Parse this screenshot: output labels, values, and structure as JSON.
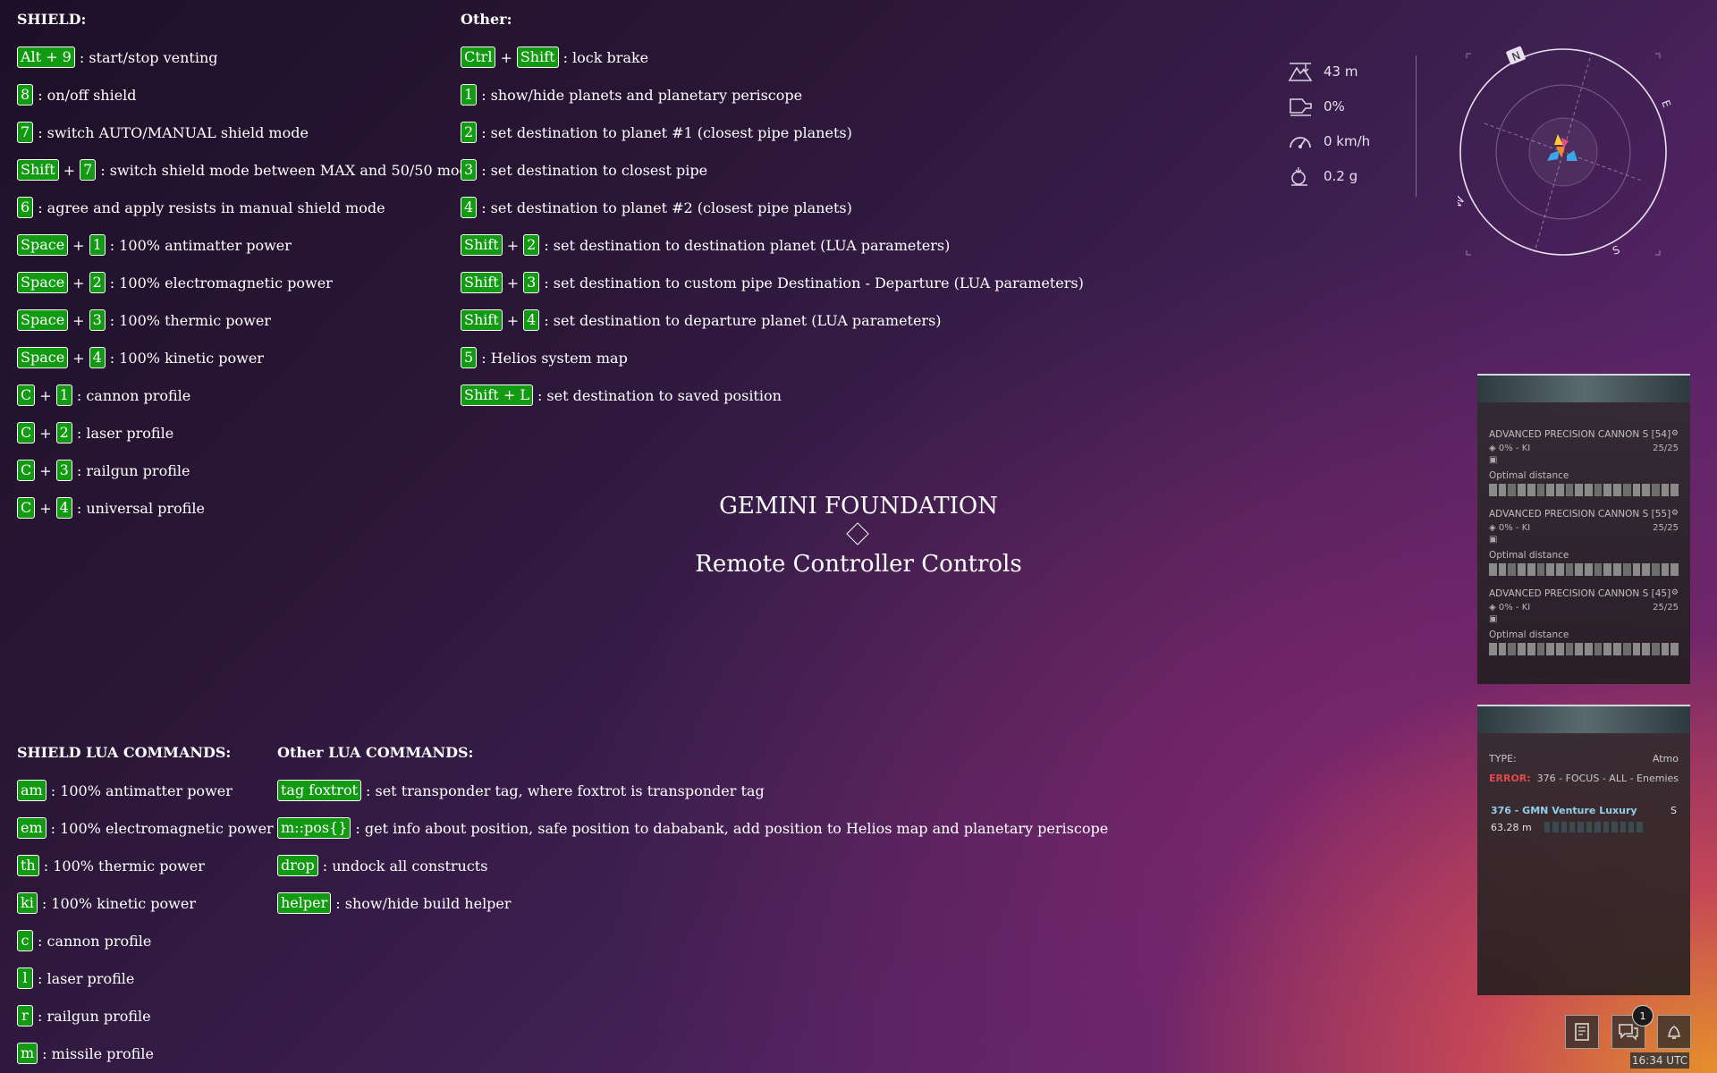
{
  "shield": {
    "title": "SHIELD:",
    "rows": [
      {
        "keys": [
          "Alt + 9"
        ],
        "desc": ": start/stop venting"
      },
      {
        "keys": [
          "8"
        ],
        "desc": ": on/off shield"
      },
      {
        "keys": [
          "7"
        ],
        "desc": ": switch AUTO/MANUAL shield mode"
      },
      {
        "keys": [
          "Shift",
          "7"
        ],
        "desc": ": switch shield mode between MAX and 50/50 mode"
      },
      {
        "keys": [
          "6"
        ],
        "desc": ": agree and apply resists in manual shield mode"
      },
      {
        "keys": [
          "Space",
          "1"
        ],
        "desc": ": 100% antimatter power"
      },
      {
        "keys": [
          "Space",
          "2"
        ],
        "desc": ": 100% electromagnetic power"
      },
      {
        "keys": [
          "Space",
          "3"
        ],
        "desc": ": 100% thermic power"
      },
      {
        "keys": [
          "Space",
          "4"
        ],
        "desc": ": 100% kinetic power"
      },
      {
        "keys": [
          "C",
          "1"
        ],
        "desc": ": cannon profile"
      },
      {
        "keys": [
          "C",
          "2"
        ],
        "desc": ": laser profile"
      },
      {
        "keys": [
          "C",
          "3"
        ],
        "desc": ": railgun profile"
      },
      {
        "keys": [
          "C",
          "4"
        ],
        "desc": ": universal profile"
      }
    ]
  },
  "other": {
    "title": "Other:",
    "rows": [
      {
        "keys": [
          "Ctrl",
          "Shift"
        ],
        "desc": ": lock brake"
      },
      {
        "keys": [
          "1"
        ],
        "desc": ": show/hide planets and planetary periscope"
      },
      {
        "keys": [
          "2"
        ],
        "desc": ": set destination to planet #1 (closest pipe planets)"
      },
      {
        "keys": [
          "3"
        ],
        "desc": ": set destination to closest pipe"
      },
      {
        "keys": [
          "4"
        ],
        "desc": ": set destination to planet #2 (closest pipe planets)"
      },
      {
        "keys": [
          "Shift",
          "2"
        ],
        "desc": ": set destination to destination planet (LUA parameters)"
      },
      {
        "keys": [
          "Shift",
          "3"
        ],
        "desc": ": set destination to custom pipe Destination - Departure (LUA parameters)"
      },
      {
        "keys": [
          "Shift",
          "4"
        ],
        "desc": ": set destination to departure planet (LUA parameters)"
      },
      {
        "keys": [
          "5"
        ],
        "desc": ": Helios system map"
      },
      {
        "keys": [
          "Shift + L"
        ],
        "desc": ": set destination to saved position"
      }
    ]
  },
  "center": {
    "title": "GEMINI FOUNDATION",
    "subtitle": "Remote Controller Controls"
  },
  "shield_lua": {
    "title": "SHIELD LUA COMMANDS:",
    "rows": [
      {
        "keys": [
          "am"
        ],
        "desc": ": 100% antimatter power"
      },
      {
        "keys": [
          "em"
        ],
        "desc": ": 100% electromagnetic power"
      },
      {
        "keys": [
          "th"
        ],
        "desc": ": 100% thermic power"
      },
      {
        "keys": [
          "ki"
        ],
        "desc": ": 100% kinetic power"
      },
      {
        "keys": [
          "c"
        ],
        "desc": ": cannon profile"
      },
      {
        "keys": [
          "l"
        ],
        "desc": ": laser profile"
      },
      {
        "keys": [
          "r"
        ],
        "desc": ": railgun profile"
      },
      {
        "keys": [
          "m"
        ],
        "desc": ": missile profile"
      }
    ]
  },
  "other_lua": {
    "title": "Other LUA COMMANDS:",
    "rows": [
      {
        "keys": [
          "tag foxtrot"
        ],
        "desc": ": set transponder tag, where foxtrot is transponder tag"
      },
      {
        "keys": [
          "m::pos{}"
        ],
        "desc": ": get info about position, safe position to dababank, add position to Helios map and planetary periscope"
      },
      {
        "keys": [
          "drop"
        ],
        "desc": ": undock all constructs"
      },
      {
        "keys": [
          "helper"
        ],
        "desc": ": show/hide build helper"
      }
    ]
  },
  "hud": {
    "altitude": "43 m",
    "throttle": "0%",
    "speed": "0 km/h",
    "gravity": "0.2 g",
    "icons": [
      "altitude-icon",
      "throttle-icon",
      "speedometer-icon",
      "gravity-icon"
    ],
    "compass": {
      "n": "N",
      "e": "E",
      "s": "S",
      "w": "W"
    }
  },
  "weapons": [
    {
      "name": "ADVANCED PRECISION CANNON S [54]",
      "status": "0% - KI",
      "ammo": "25/25",
      "label": "Optimal distance"
    },
    {
      "name": "ADVANCED PRECISION CANNON S [55]",
      "status": "0% - KI",
      "ammo": "25/25",
      "label": "Optimal distance"
    },
    {
      "name": "ADVANCED PRECISION CANNON S [45]",
      "status": "0% - KI",
      "ammo": "25/25",
      "label": "Optimal distance"
    }
  ],
  "target": {
    "type_label": "TYPE:",
    "type_value": "Atmo",
    "error_label": "ERROR:",
    "error_value": "376 - FOCUS - ALL - Enemies",
    "name": "376 - GMN Venture Luxury",
    "size": "S",
    "distance": "63.28 m"
  },
  "dock": {
    "badge": "1",
    "clock": "16:34 UTC"
  }
}
